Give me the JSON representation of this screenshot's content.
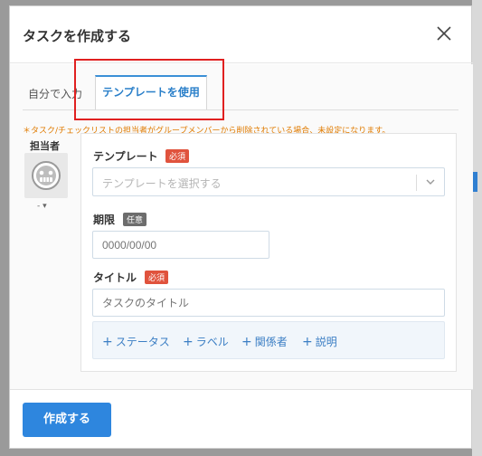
{
  "dialog": {
    "title": "タスクを作成する",
    "close_icon": "close-icon"
  },
  "tabs": [
    {
      "label": "自分で入力",
      "active": false
    },
    {
      "label": "テンプレートを使用",
      "active": true
    }
  ],
  "notice": "＊タスク/チェックリストの担当者がグループメンバーから削除されている場合、未設定になります。",
  "assignee": {
    "label": "担当者",
    "selected": "-",
    "avatar_icon": "default-avatar-icon"
  },
  "fields": {
    "template": {
      "label": "テンプレート",
      "badge": "必須",
      "placeholder": "テンプレートを選択する"
    },
    "due": {
      "label": "期限",
      "badge": "任意",
      "placeholder": "0000/00/00"
    },
    "title": {
      "label": "タイトル",
      "badge": "必須",
      "placeholder": "タスクのタイトル"
    }
  },
  "actions": [
    {
      "label": "ステータス"
    },
    {
      "label": "ラベル"
    },
    {
      "label": "関係者"
    },
    {
      "label": "説明"
    }
  ],
  "footer": {
    "create_label": "作成する"
  },
  "colors": {
    "accent": "#2e86de",
    "required": "#e0533d",
    "optional": "#6d6d6d",
    "notice": "#e07b00",
    "highlight_frame": "#e02020"
  }
}
